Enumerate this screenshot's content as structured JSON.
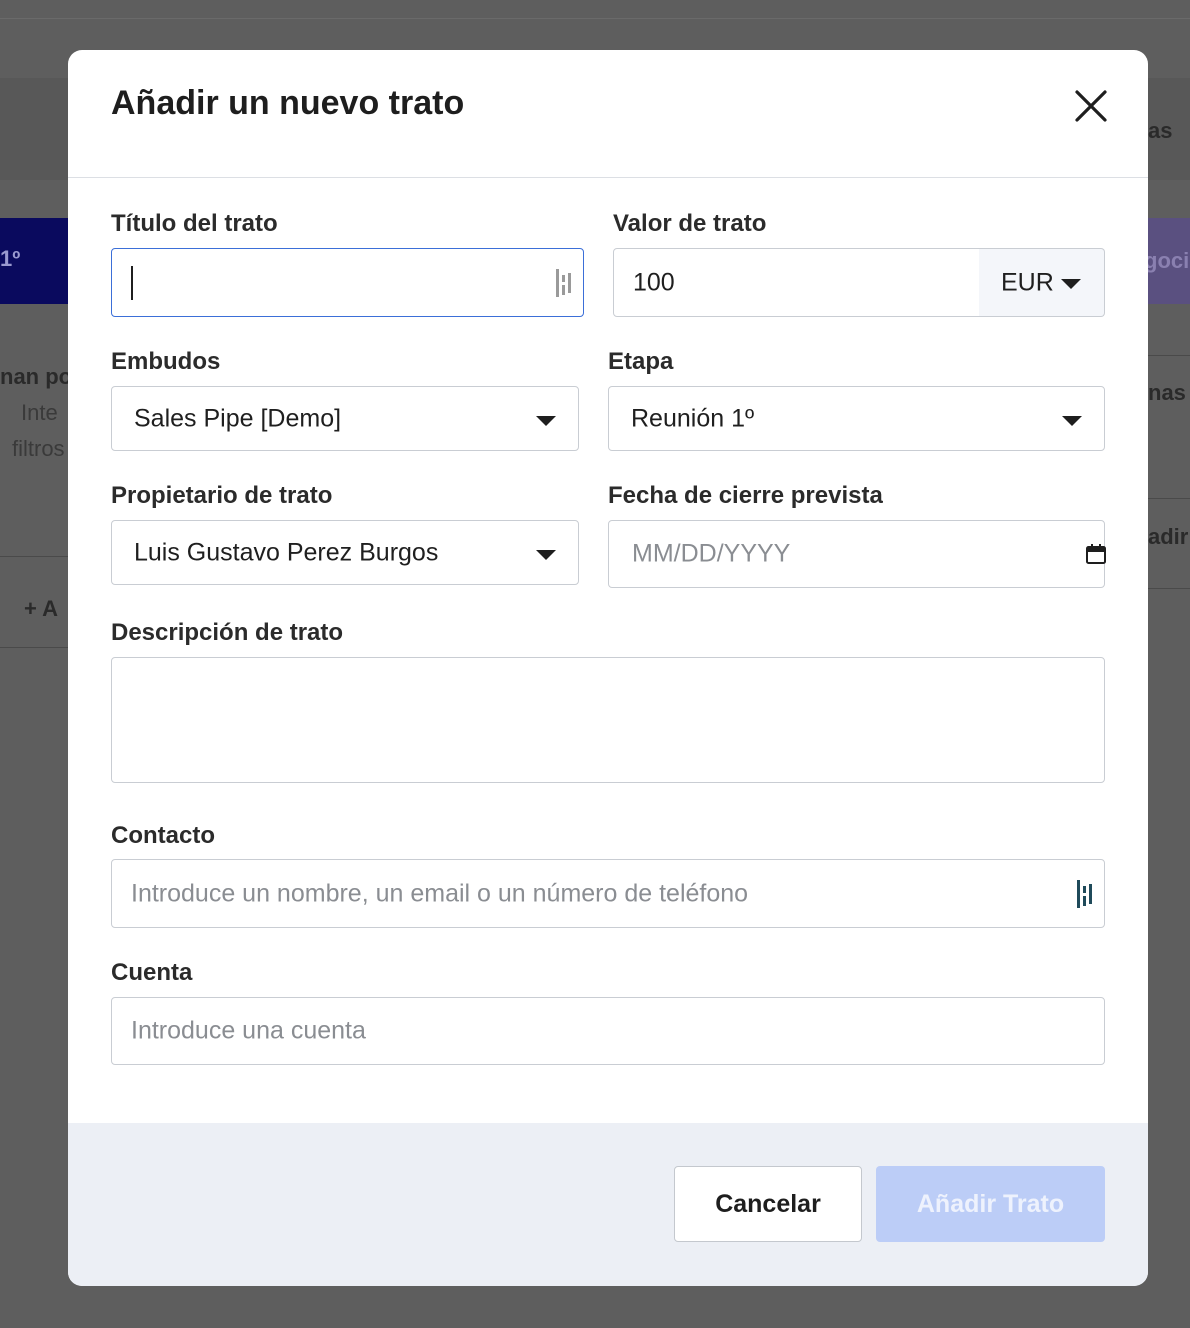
{
  "background": {
    "partial_texts": {
      "top_right": "as",
      "left_column_header": "1º",
      "right_column_header": "goci",
      "left_line1": "nan po",
      "left_line2": "Inte",
      "left_line3": "filtros",
      "right_line1": "nas",
      "right_line2": "adir",
      "add_button": "+ A"
    }
  },
  "modal": {
    "title": "Añadir un nuevo trato",
    "close_icon": "close-icon",
    "fields": {
      "deal_title": {
        "label": "Título del trato",
        "value": ""
      },
      "deal_value": {
        "label": "Valor de trato",
        "value": "100",
        "currency": "EUR"
      },
      "pipeline": {
        "label": "Embudos",
        "value": "Sales Pipe [Demo]"
      },
      "stage": {
        "label": "Etapa",
        "value": "Reunión 1º"
      },
      "owner": {
        "label": "Propietario de trato",
        "value": "Luis Gustavo Perez Burgos"
      },
      "close_date": {
        "label": "Fecha de cierre prevista",
        "placeholder": "MM/DD/YYYY"
      },
      "description": {
        "label": "Descripción de trato",
        "value": ""
      },
      "contact": {
        "label": "Contacto",
        "placeholder": "Introduce un nombre, un email o un número de teléfono"
      },
      "account": {
        "label": "Cuenta",
        "placeholder": "Introduce una cuenta"
      }
    },
    "footer": {
      "cancel_label": "Cancelar",
      "submit_label": "Añadir Trato"
    }
  },
  "colors": {
    "overlay": "#5e5e5e",
    "focus_border": "#3b6fd8",
    "submit_disabled": "#bccdf7",
    "footer_bg": "#eceff5"
  }
}
